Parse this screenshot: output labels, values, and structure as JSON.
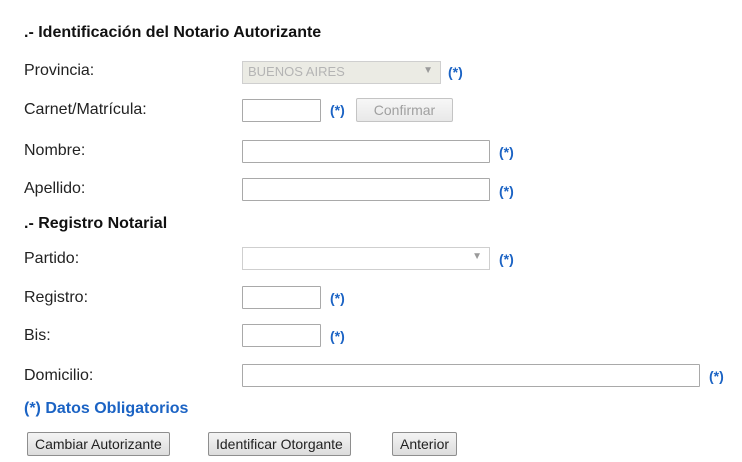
{
  "notary_section": {
    "title": ".- Identificación del Notario Autorizante",
    "provincia_label": "Provincia:",
    "provincia_value": "BUENOS AIRES",
    "carnet_label": "Carnet/Matrícula:",
    "carnet_value": "",
    "confirm_label": "Confirmar",
    "nombre_label": "Nombre:",
    "nombre_value": "",
    "apellido_label": "Apellido:",
    "apellido_value": ""
  },
  "registry_section": {
    "title": ".- Registro Notarial",
    "partido_label": "Partido:",
    "partido_value": "",
    "registro_label": "Registro:",
    "registro_value": "",
    "bis_label": "Bis:",
    "bis_value": "",
    "domicilio_label": "Domicilio:",
    "domicilio_value": ""
  },
  "required_marker": "(*)",
  "required_note": "(*) Datos Obligatorios",
  "buttons": {
    "change": "Cambiar Autorizante",
    "identify": "Identificar Otorgante",
    "previous": "Anterior"
  },
  "colors": {
    "required_blue": "#1b63c4",
    "disabled_bg": "#ebebe4"
  },
  "icons": {
    "dropdown": "chevron-down-icon"
  }
}
